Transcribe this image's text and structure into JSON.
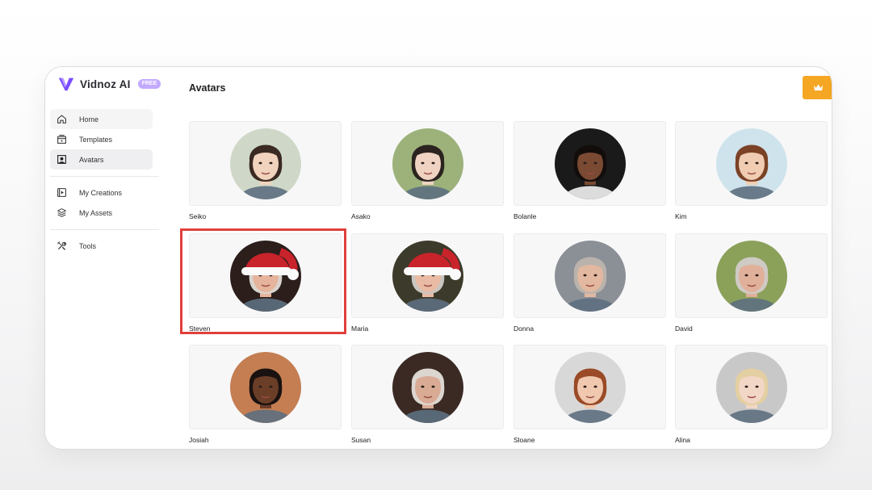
{
  "app": {
    "name": "Vidnoz AI",
    "badge": "FREE"
  },
  "sidebar": {
    "items": [
      {
        "label": "Home",
        "icon": "home-icon"
      },
      {
        "label": "Templates",
        "icon": "templates-icon"
      },
      {
        "label": "Avatars",
        "icon": "avatar-icon",
        "active": true
      },
      {
        "label": "My Creations",
        "icon": "play-box-icon"
      },
      {
        "label": "My Assets",
        "icon": "layers-icon"
      },
      {
        "label": "Tools",
        "icon": "tools-icon"
      }
    ]
  },
  "page": {
    "title": "Avatars"
  },
  "upgrade": {
    "icon": "crown-icon",
    "color": "#f5a623"
  },
  "avatars": [
    {
      "name": "Seiko",
      "bg": "#cfd8c8",
      "skin": "#f1d3bd",
      "hair": "#3a2a22"
    },
    {
      "name": "Asako",
      "bg": "#9db27a",
      "skin": "#efd2c2",
      "hair": "#2b2320"
    },
    {
      "name": "Bolanle",
      "bg": "#1a1a1a",
      "skin": "#7a4a33",
      "hair": "#120d0b"
    },
    {
      "name": "Kim",
      "bg": "#cfe3ec",
      "skin": "#f0cdb2",
      "hair": "#7b4226"
    },
    {
      "name": "Steven",
      "bg": "#2b1e1b",
      "skin": "#e6b49c",
      "hair": "#d9d4cf",
      "hat": true,
      "selected": true
    },
    {
      "name": "Maria",
      "bg": "#3c3a2a",
      "skin": "#e9bba5",
      "hair": "#c9c5c0",
      "hat": true
    },
    {
      "name": "Donna",
      "bg": "#8b8f96",
      "skin": "#e2b8a0",
      "hair": "#b9b3ac"
    },
    {
      "name": "David",
      "bg": "#8ba15a",
      "skin": "#e0b09a",
      "hair": "#cfcac4"
    },
    {
      "name": "Josiah",
      "bg": "#c47e52",
      "skin": "#6b3e28",
      "hair": "#1a1210"
    },
    {
      "name": "Susan",
      "bg": "#3b2a24",
      "skin": "#d9ab95",
      "hair": "#dcd6d0"
    },
    {
      "name": "Sloane",
      "bg": "#d8d8d8",
      "skin": "#f0c8b0",
      "hair": "#9a4a26"
    },
    {
      "name": "Alina",
      "bg": "#c8c8c8",
      "skin": "#f2d6c6",
      "hair": "#e4cfa2"
    }
  ],
  "colors": {
    "selection": "#e0403b",
    "accent_purple": "#7b4dff"
  }
}
